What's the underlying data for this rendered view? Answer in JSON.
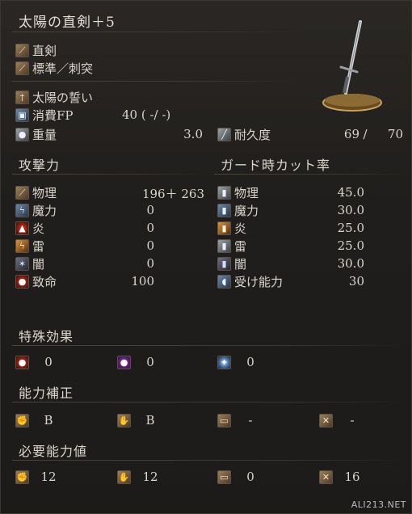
{
  "weapon": {
    "name": "太陽の直剣＋5",
    "category": "直剣",
    "attack_type": "標準／刺突",
    "skill": "太陽の誓い",
    "fp_label": "消費FP",
    "fp_value": "40 (   -/   -)",
    "weight_label": "重量",
    "weight_value": "3.0",
    "durability_label": "耐久度",
    "durability_current": "69",
    "durability_max": "70"
  },
  "attack": {
    "header": "攻撃力",
    "rows": [
      {
        "icon": "physical-icon",
        "label": "物理",
        "value": "196＋  263"
      },
      {
        "icon": "magic-icon",
        "label": "魔力",
        "value": "0"
      },
      {
        "icon": "fire-icon",
        "label": "炎",
        "value": "0"
      },
      {
        "icon": "lightning-icon",
        "label": "雷",
        "value": "0"
      },
      {
        "icon": "dark-icon",
        "label": "闇",
        "value": "0"
      },
      {
        "icon": "critical-icon",
        "label": "致命",
        "value": "100"
      }
    ]
  },
  "guard": {
    "header": "ガード時カット率",
    "rows": [
      {
        "icon": "physical-guard-icon",
        "label": "物理",
        "value": "45.0"
      },
      {
        "icon": "magic-guard-icon",
        "label": "魔力",
        "value": "30.0"
      },
      {
        "icon": "fire-guard-icon",
        "label": "炎",
        "value": "25.0"
      },
      {
        "icon": "lightning-guard-icon",
        "label": "雷",
        "value": "25.0"
      },
      {
        "icon": "dark-guard-icon",
        "label": "闇",
        "value": "30.0"
      },
      {
        "icon": "stability-icon",
        "label": "受け能力",
        "value": "30"
      }
    ]
  },
  "effects": {
    "header": "特殊効果",
    "items": [
      {
        "icon": "bleed-icon",
        "value": "0"
      },
      {
        "icon": "poison-icon",
        "value": "0"
      },
      {
        "icon": "frost-icon",
        "value": "0"
      }
    ]
  },
  "scaling": {
    "header": "能力補正",
    "items": [
      {
        "icon": "strength-icon",
        "value": "B"
      },
      {
        "icon": "dexterity-icon",
        "value": "B"
      },
      {
        "icon": "intelligence-icon",
        "value": "-"
      },
      {
        "icon": "faith-icon",
        "value": "-"
      }
    ]
  },
  "requirements": {
    "header": "必要能力値",
    "items": [
      {
        "icon": "strength-req-icon",
        "value": "12"
      },
      {
        "icon": "dexterity-req-icon",
        "value": "12"
      },
      {
        "icon": "intelligence-req-icon",
        "value": "0"
      },
      {
        "icon": "faith-req-icon",
        "value": "16"
      }
    ]
  },
  "watermark": "ALI213.NET"
}
